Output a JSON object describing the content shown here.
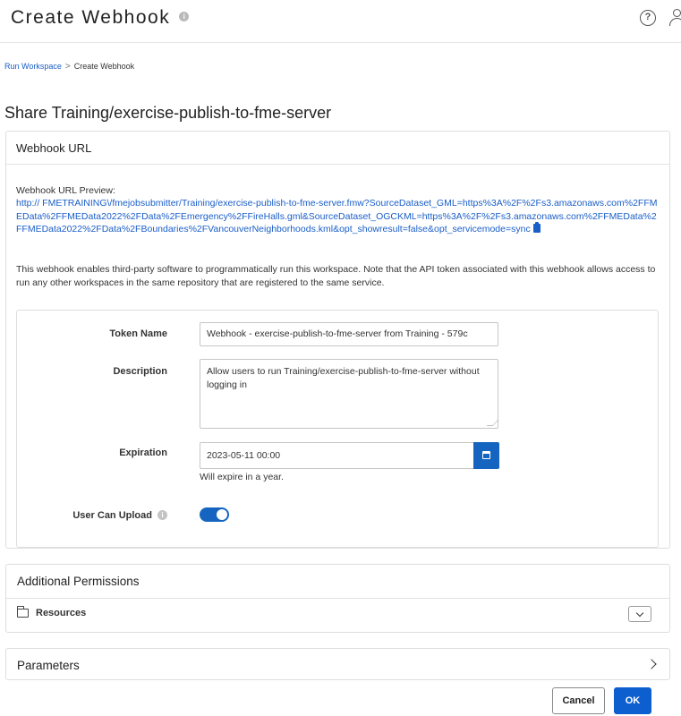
{
  "header": {
    "title": "Create Webhook",
    "info_glyph": "i",
    "help_glyph": "?"
  },
  "breadcrumb": {
    "parent": "Run Workspace",
    "current": "Create Webhook"
  },
  "share_title": "Share Training/exercise-publish-to-fme-server",
  "webhook_card": {
    "title": "Webhook URL",
    "preview_label": "Webhook URL Preview:",
    "preview_url": "http:// FMETRAINING\\/fmejobsubmitter/Training/exercise-publish-to-fme-server.fmw?SourceDataset_GML=https%3A%2F%2Fs3.amazonaws.com%2FFMEData%2FFMEData2022%2FData%2FEmergency%2FFireHalls.gml&SourceDataset_OGCKML=https%3A%2F%2Fs3.amazonaws.com%2FFMEData%2FFMEData2022%2FData%2FBoundaries%2FVancouverNeighborhoods.kml&opt_showresult=false&opt_servicemode=sync",
    "note": "This webhook enables third-party software to programmatically run this workspace. Note that the API token associated with this webhook allows access to run any other workspaces in the same repository that are registered to the same service."
  },
  "form": {
    "token_name_label": "Token Name",
    "token_name_value": "Webhook - exercise-publish-to-fme-server from Training - 579c",
    "description_label": "Description",
    "description_value": "Allow users to run Training/exercise-publish-to-fme-server without logging in",
    "expiration_label": "Expiration",
    "expiration_value": "2023-05-11 00:00",
    "expiration_hint": "Will expire in a year.",
    "user_can_upload_label": "User Can Upload",
    "user_can_upload": true,
    "info_glyph": "i"
  },
  "additional_permissions": {
    "title": "Additional Permissions",
    "resources_label": "Resources"
  },
  "parameters": {
    "title": "Parameters"
  },
  "actions": {
    "cancel_label": "Cancel",
    "ok_label": "OK"
  },
  "colors": {
    "accent": "#1565c0",
    "link": "#1a5ec8"
  }
}
